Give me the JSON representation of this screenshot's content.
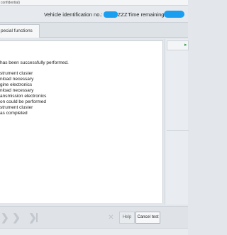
{
  "confidential_label": "confidential)",
  "header": {
    "vin_label": "Vehicle identification no.: WVWZZZ",
    "time_label": "Time remaining:",
    "mask_color": "#1a9ff0"
  },
  "tab": {
    "label": "pecial functions"
  },
  "main": {
    "message": "has been successfully performed.",
    "log_lines": [
      "strument cluster",
      "nload necessary",
      "gine electronics",
      "nload necessary",
      "ansmission electronics",
      "on could be performed",
      "strument cluster",
      "as completed"
    ]
  },
  "side": {
    "play_icon": "play-icon"
  },
  "footer": {
    "prev_icon": "chevron-left-icon",
    "next_icon": "chevron-right-icon",
    "last_icon": "skip-to-end-icon",
    "close_icon": "close-icon",
    "help_label": "Help",
    "cancel_label": "Cancel test"
  }
}
